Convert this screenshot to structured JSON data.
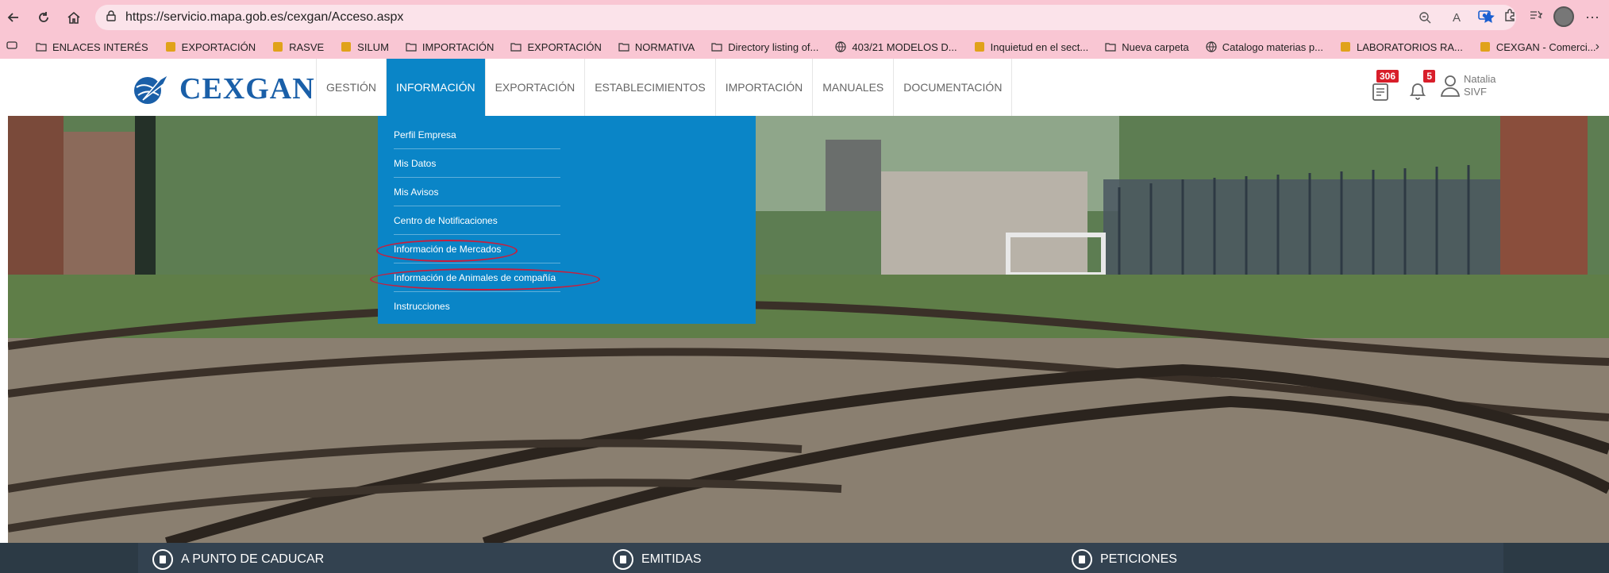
{
  "browser": {
    "url": "https://servicio.mapa.gob.es/cexgan/Acceso.aspx"
  },
  "bookmarks": [
    {
      "label": "ENLACES INTERÉS",
      "icon": "folder-icon"
    },
    {
      "label": "EXPORTACIÓN",
      "icon": "site-icon"
    },
    {
      "label": "RASVE",
      "icon": "site-icon"
    },
    {
      "label": "SILUM",
      "icon": "site-icon"
    },
    {
      "label": "IMPORTACIÓN",
      "icon": "folder-icon"
    },
    {
      "label": "EXPORTACIÓN",
      "icon": "folder-icon"
    },
    {
      "label": "NORMATIVA",
      "icon": "folder-icon"
    },
    {
      "label": "Directory listing of...",
      "icon": "folder-icon"
    },
    {
      "label": "403/21 MODELOS D...",
      "icon": "globe-icon"
    },
    {
      "label": "Inquietud en el sect...",
      "icon": "site-icon"
    },
    {
      "label": "Nueva carpeta",
      "icon": "folder-icon"
    },
    {
      "label": "Catalogo materias p...",
      "icon": "globe-icon"
    },
    {
      "label": "LABORATORIOS RA...",
      "icon": "site-icon"
    },
    {
      "label": "CEXGAN - Comerci...",
      "icon": "site-icon"
    }
  ],
  "site": {
    "logo_text": "CEXGAN",
    "nav": [
      "GESTIÓN",
      "INFORMACIÓN",
      "EXPORTACIÓN",
      "ESTABLECIMIENTOS",
      "IMPORTACIÓN",
      "MANUALES",
      "DOCUMENTACIÓN"
    ],
    "active_nav": "INFORMACIÓN",
    "tasks_badge": "306",
    "alerts_badge": "5",
    "user_first": "Natalia",
    "user_second": "SIVF"
  },
  "dropdown": {
    "items": [
      "Perfil Empresa",
      "Mis Datos",
      "Mis Avisos",
      "Centro de Notificaciones",
      "Información de Mercados",
      "Información de Animales de compañía",
      "Instrucciones"
    ],
    "highlighted": [
      "Información de Mercados",
      "Información de Animales de compañía"
    ],
    "highlight_color": "#c81e3c"
  },
  "bottom": {
    "items": [
      {
        "label": "A PUNTO DE CADUCAR",
        "icon": "clipboard-icon"
      },
      {
        "label": "EMITIDAS",
        "icon": "document-icon"
      },
      {
        "label": "PETICIONES",
        "icon": "calendar-icon"
      }
    ]
  },
  "colors": {
    "brand_blue": "#1a5fa8",
    "menu_blue": "#0a85c7",
    "badge_red": "#d81e2a",
    "browser_pink": "#f9c6d3"
  }
}
